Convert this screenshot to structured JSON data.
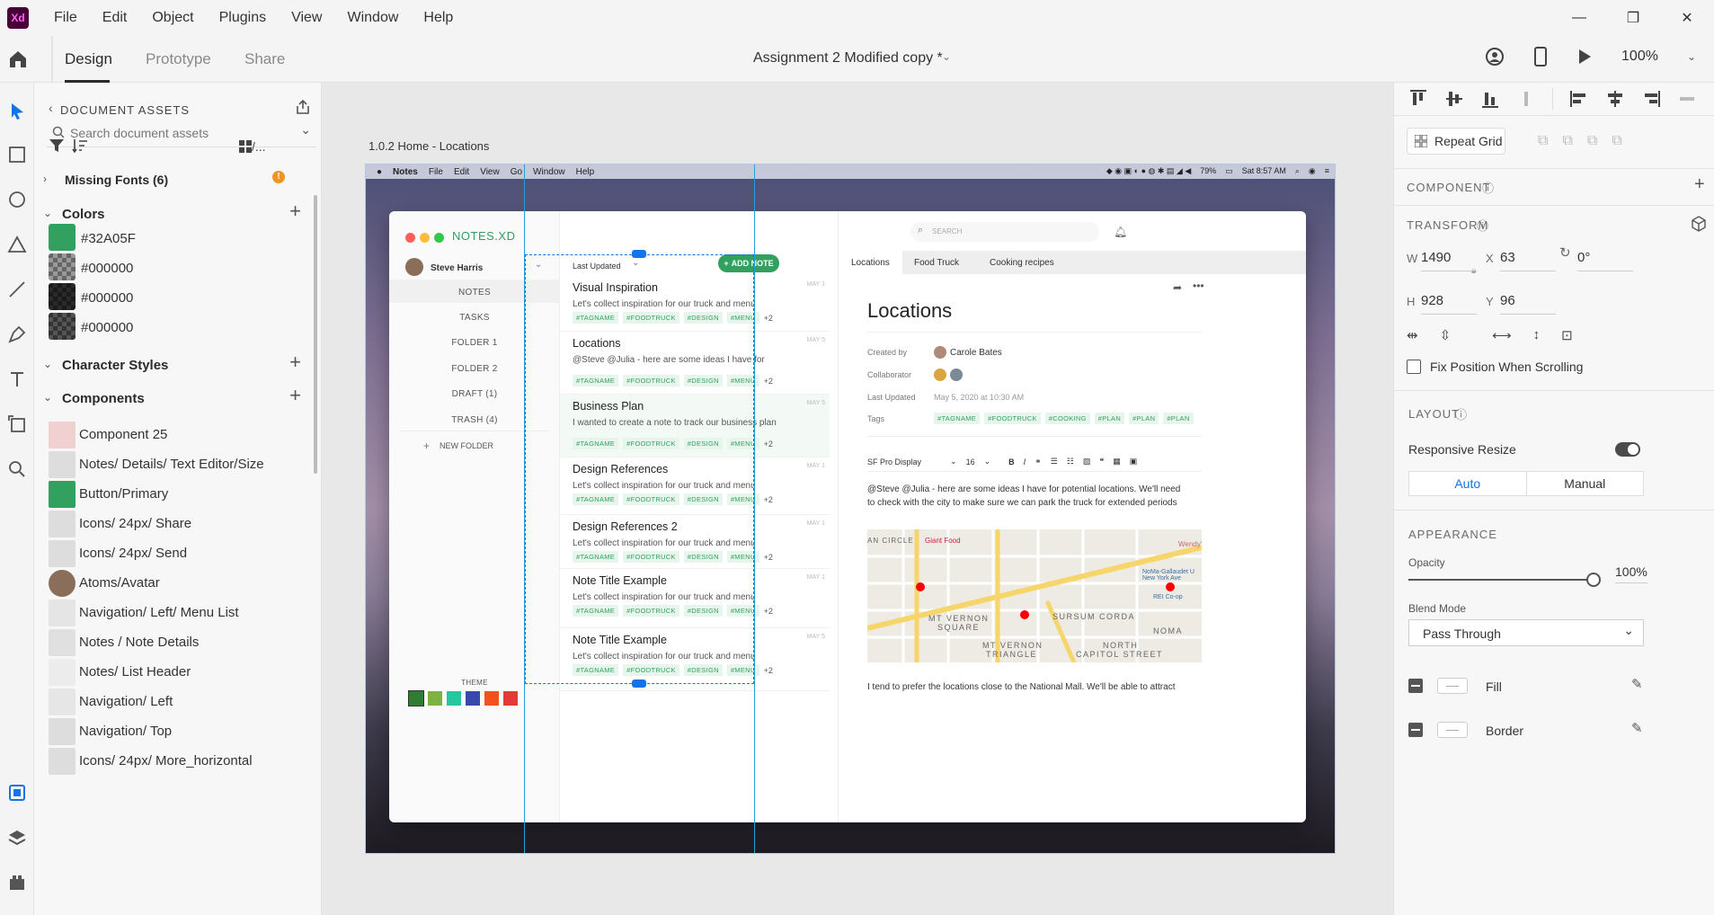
{
  "app": {
    "logo": "Xd",
    "menu": [
      "File",
      "Edit",
      "Object",
      "Plugins",
      "View",
      "Window",
      "Help"
    ]
  },
  "tabs": {
    "design": "Design",
    "prototype": "Prototype",
    "share": "Share"
  },
  "doc_title": "Assignment 2 Modified copy *",
  "zoom": "100%",
  "assets": {
    "header": "DOCUMENT ASSETS",
    "search_placeholder": "Search document assets",
    "missing_fonts": "Missing Fonts (6)",
    "colors_h": "Colors",
    "colors": [
      {
        "label": "#32A05F",
        "hex": "#32A05F"
      },
      {
        "label": "#000000",
        "hex": "#000000"
      },
      {
        "label": "#000000",
        "hex": "#000000"
      },
      {
        "label": "#000000",
        "hex": "#000000"
      }
    ],
    "char_styles_h": "Character Styles",
    "components_h": "Components",
    "components": [
      "Component 25",
      "Notes/ Details/ Text Editor/Size",
      "Button/Primary",
      "Icons/ 24px/ Share",
      "Icons/ 24px/ Send",
      "Atoms/Avatar",
      "Navigation/ Left/ Menu List",
      "Notes / Note Details",
      "Notes/ List Header",
      "Navigation/ Left",
      "Navigation/ Top",
      "Icons/ 24px/ More_horizontal"
    ]
  },
  "canvas": {
    "artboard_label": "1.0.2 Home - Locations"
  },
  "mac": {
    "app": "Notes",
    "menu": [
      "File",
      "Edit",
      "View",
      "Go",
      "Window",
      "Help"
    ],
    "battery": "79%",
    "clock": "Sat 8:57 AM"
  },
  "notes_app": {
    "brand": "NOTES.XD",
    "search_placeholder": "SEARCH",
    "user": "Steve Harris",
    "nav": [
      "NOTES",
      "TASKS",
      "FOLDER 1",
      "FOLDER 2",
      "DRAFT (1)",
      "TRASH (4)"
    ],
    "new_folder": "NEW FOLDER",
    "theme_label": "THEME",
    "theme_colors": [
      "#2e7d32",
      "#7cb342",
      "#26c6a0",
      "#3949ab",
      "#f4511e",
      "#e53935"
    ],
    "sort": "Last Updated",
    "add_note": "ADD NOTE",
    "notes": [
      {
        "title": "Visual Inspiration",
        "body": "Let's collect inspiration for our truck and menu",
        "date": "MAY 1"
      },
      {
        "title": "Locations",
        "body": "@Steve @Julia - here are some ideas I have for",
        "date": "MAY 5"
      },
      {
        "title": "Business Plan",
        "body": "I wanted to create a note to track our business plan",
        "date": "MAY 5"
      },
      {
        "title": "Design References",
        "body": "Let's collect inspiration for our truck and menu",
        "date": "MAY 1"
      },
      {
        "title": "Design References 2",
        "body": "Let's collect inspiration for our truck and menu",
        "date": "MAY 1"
      },
      {
        "title": "Note Title Example",
        "body": "Let's collect inspiration for our truck and menu",
        "date": "MAY 1"
      },
      {
        "title": "Note Title Example",
        "body": "Let's collect inspiration for our truck and menu",
        "date": "MAY 5"
      }
    ],
    "tags": [
      "#TAGNAME",
      "#FOODTRUCK",
      "#DESIGN",
      "#MENU"
    ],
    "tags_more": "+2",
    "detail_tabs": [
      "Locations",
      "Food Truck",
      "Cooking recipes"
    ],
    "detail_title": "Locations",
    "meta": {
      "created_k": "Created by",
      "created_v": "Carole Bates",
      "collab_k": "Collaborator",
      "updated_k": "Last Updated",
      "updated_v": "May 5, 2020 at 10:30 AM",
      "tags_k": "Tags"
    },
    "detail_tags": [
      "#TAGNAME",
      "#FOODTRUCK",
      "#COOKING",
      "#PLAN",
      "#PLAN",
      "#PLAN"
    ],
    "font": "SF Pro Display",
    "font_size": "16",
    "para1": "@Steve @Julia - here are some ideas I have for potential locations. We'll need",
    "para2": "to check with the city to make sure we can park the truck for extended periods",
    "map_labels": [
      "AN CIRCLE",
      "Giant Food",
      "MT VERNON",
      "SQUARE",
      "SURSUM CORDA",
      "NOMA",
      "MT VERNON",
      "TRIANGLE",
      "NORTH",
      "CAPITOL STREET",
      "Wendy's",
      "NoMa-Gallaudet U New York Ave",
      "REI Co-op"
    ],
    "para3": "I tend to prefer the locations close to the National Mall. We'll be able to attract"
  },
  "props": {
    "repeat_grid": "Repeat Grid",
    "component_h": "COMPONENT",
    "transform_h": "TRANSFORM",
    "w": "1490",
    "x": "63",
    "h": "928",
    "y": "96",
    "rotation": "0°",
    "fix_position": "Fix Position When Scrolling",
    "layout_h": "LAYOUT",
    "responsive": "Responsive Resize",
    "auto": "Auto",
    "manual": "Manual",
    "appearance_h": "APPEARANCE",
    "opacity_label": "Opacity",
    "opacity": "100%",
    "blend_label": "Blend Mode",
    "blend": "Pass Through",
    "fill": "Fill",
    "border": "Border"
  }
}
